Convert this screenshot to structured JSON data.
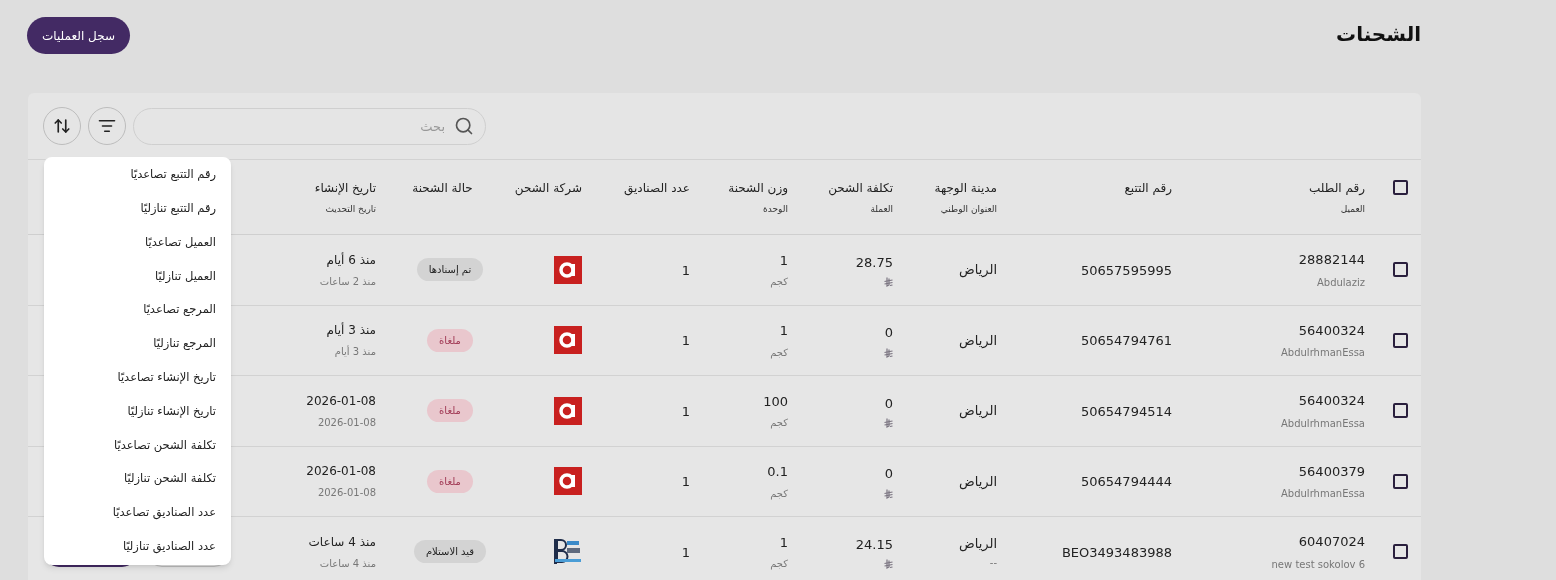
{
  "page": {
    "title": "الشحنات",
    "log_button": "سجل العمليات"
  },
  "toolbar": {
    "search": {
      "placeholder": "بحث"
    }
  },
  "table": {
    "select_all": {
      "checked": false
    },
    "columns": [
      {
        "label": "رقم الطلب",
        "sublabel": "العميل"
      },
      {
        "label": "رقم التتبع"
      },
      {
        "label": "مدينة الوجهة",
        "sublabel": "العنوان الوطني"
      },
      {
        "label": "تكلفة الشحن",
        "sublabel": "العملة"
      },
      {
        "label": "وزن الشحنة",
        "sublabel": "الوحدة"
      },
      {
        "label": "عدد الصناديق"
      },
      {
        "label": "شركة الشحن"
      },
      {
        "label": "حالة الشحنة"
      },
      {
        "label": "تاريخ الإنشاء",
        "sublabel": "تاريخ التحديث"
      }
    ],
    "rows": [
      {
        "checked": false,
        "order": "28882144",
        "customer": "Abdulaziz",
        "tracking": "50657595995",
        "city": "الرياض",
        "cost": "28.75",
        "weight": "1",
        "unit": "كجم",
        "boxes": "1",
        "carrier": {
          "kind": "aramex"
        },
        "status": {
          "label": "تم إسنادها",
          "kind": "neutral"
        },
        "created": "منذ 6 أيام",
        "updated": "منذ 2 ساعات"
      },
      {
        "checked": false,
        "order": "56400324",
        "customer": "AbdulrhmanEssa",
        "tracking": "50654794761",
        "city": "الرياض",
        "cost": "0",
        "weight": "1",
        "unit": "كجم",
        "boxes": "1",
        "carrier": {
          "kind": "aramex"
        },
        "status": {
          "label": "ملغاة",
          "kind": "cancelled"
        },
        "created": "منذ 3 أيام",
        "updated": "منذ 3 أيام"
      },
      {
        "checked": false,
        "order": "56400324",
        "customer": "AbdulrhmanEssa",
        "tracking": "50654794514",
        "city": "الرياض",
        "cost": "0",
        "weight": "100",
        "unit": "كجم",
        "boxes": "1",
        "carrier": {
          "kind": "aramex"
        },
        "status": {
          "label": "ملغاة",
          "kind": "cancelled"
        },
        "created": "2026-01-08",
        "updated": "2026-01-08"
      },
      {
        "checked": false,
        "order": "56400379",
        "customer": "AbdulrhmanEssa",
        "tracking": "50654794444",
        "city": "الرياض",
        "cost": "0",
        "weight": "0.1",
        "unit": "كجم",
        "boxes": "1",
        "carrier": {
          "kind": "aramex"
        },
        "status": {
          "label": "ملغاة",
          "kind": "cancelled"
        },
        "created": "2026-01-08",
        "updated": "2026-01-08"
      },
      {
        "checked": false,
        "order": "60407024",
        "customer": "new test sokolov 6",
        "tracking": "BEO3493483988",
        "city": "الرياض",
        "address": "--",
        "cost": "24.15",
        "weight": "1",
        "unit": "كجم",
        "boxes": "1",
        "carrier": {
          "kind": "beone"
        },
        "status": {
          "label": "قيد الاستلام",
          "kind": "neutral"
        },
        "created": "منذ 4 ساعات",
        "updated": "منذ 4 ساعات"
      }
    ]
  },
  "sort_menu": {
    "items": [
      "رقم التتبع تصاعديًا",
      "رقم التتبع تنازليًا",
      "العميل تصاعديًا",
      "العميل تنازليًا",
      "المرجع تصاعديًا",
      "المرجع تنازليًا",
      "تاريخ الإنشاء تصاعديًا",
      "تاريخ الإنشاء تنازليًا",
      "تكلفة الشحن تصاعديًا",
      "تكلفة الشحن تنازليًا",
      "عدد الصناديق تصاعديًا",
      "عدد الصناديق تنازليًا"
    ]
  }
}
